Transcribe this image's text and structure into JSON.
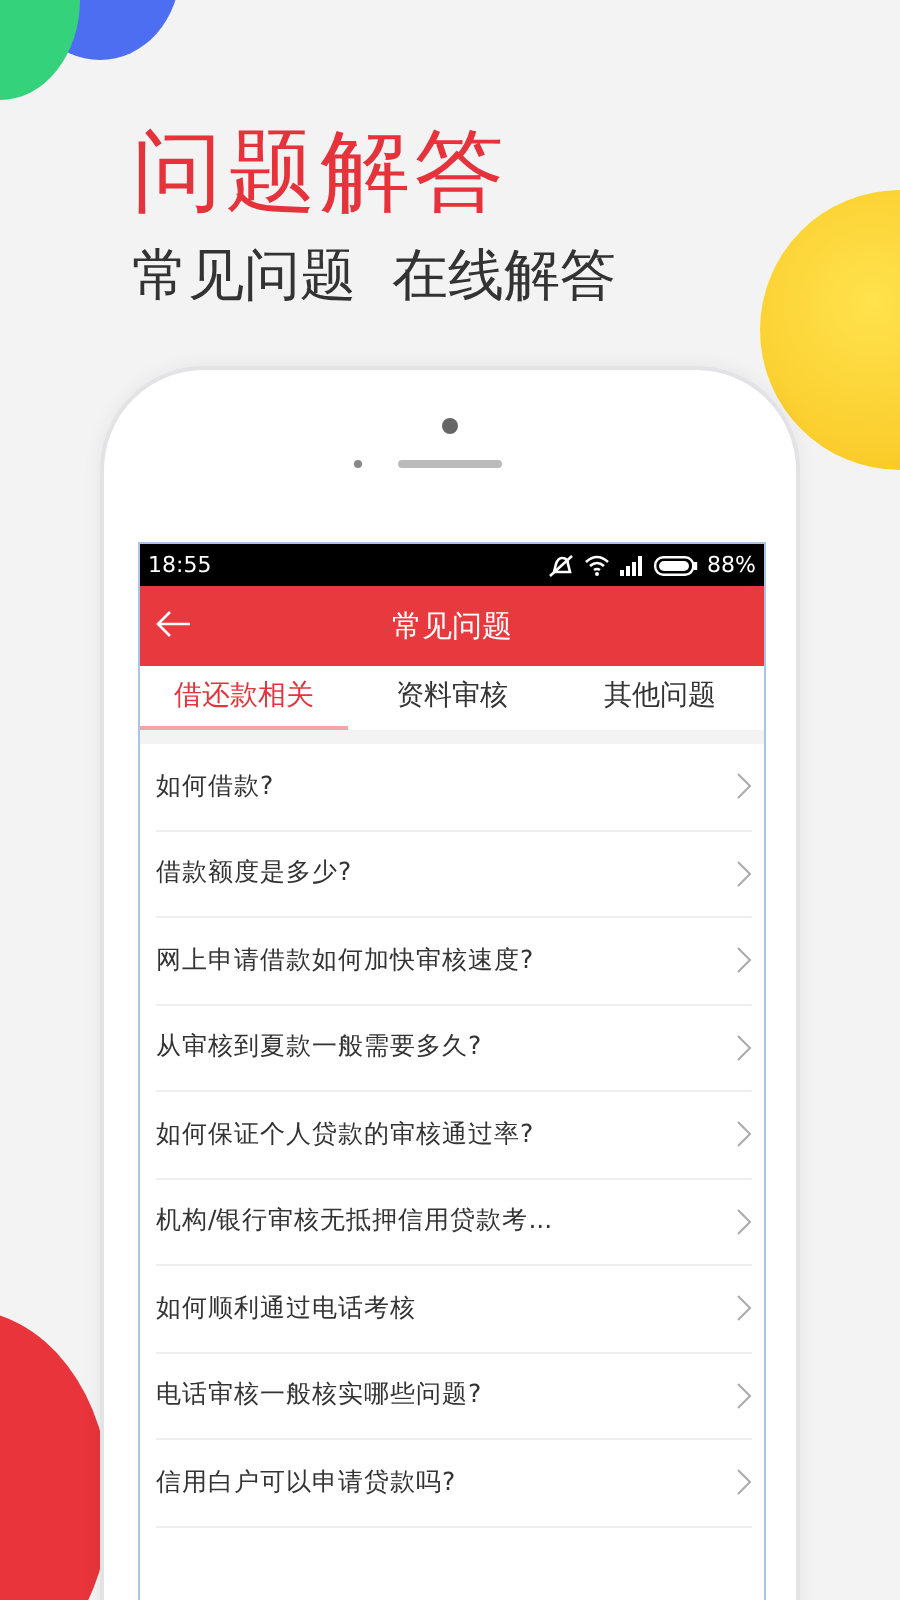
{
  "headline": "问题解答",
  "subheadline": "常见问题  在线解答",
  "status_bar": {
    "time": "18:55",
    "battery": "88%"
  },
  "nav": {
    "title": "常见问题"
  },
  "tabs": [
    {
      "label": "借还款相关",
      "selected": true
    },
    {
      "label": "资料审核",
      "selected": false
    },
    {
      "label": "其他问题",
      "selected": false
    }
  ],
  "questions": [
    "如何借款?",
    "借款额度是多少?",
    "网上申请借款如何加快审核速度?",
    "从审核到夏款一般需要多久?",
    "如何保证个人贷款的审核通过率?",
    "机构/银行审核无抵押信用贷款考...",
    "如何顺利通过电话考核",
    "电话审核一般核实哪些问题?",
    "信用白户可以申请贷款吗?"
  ]
}
